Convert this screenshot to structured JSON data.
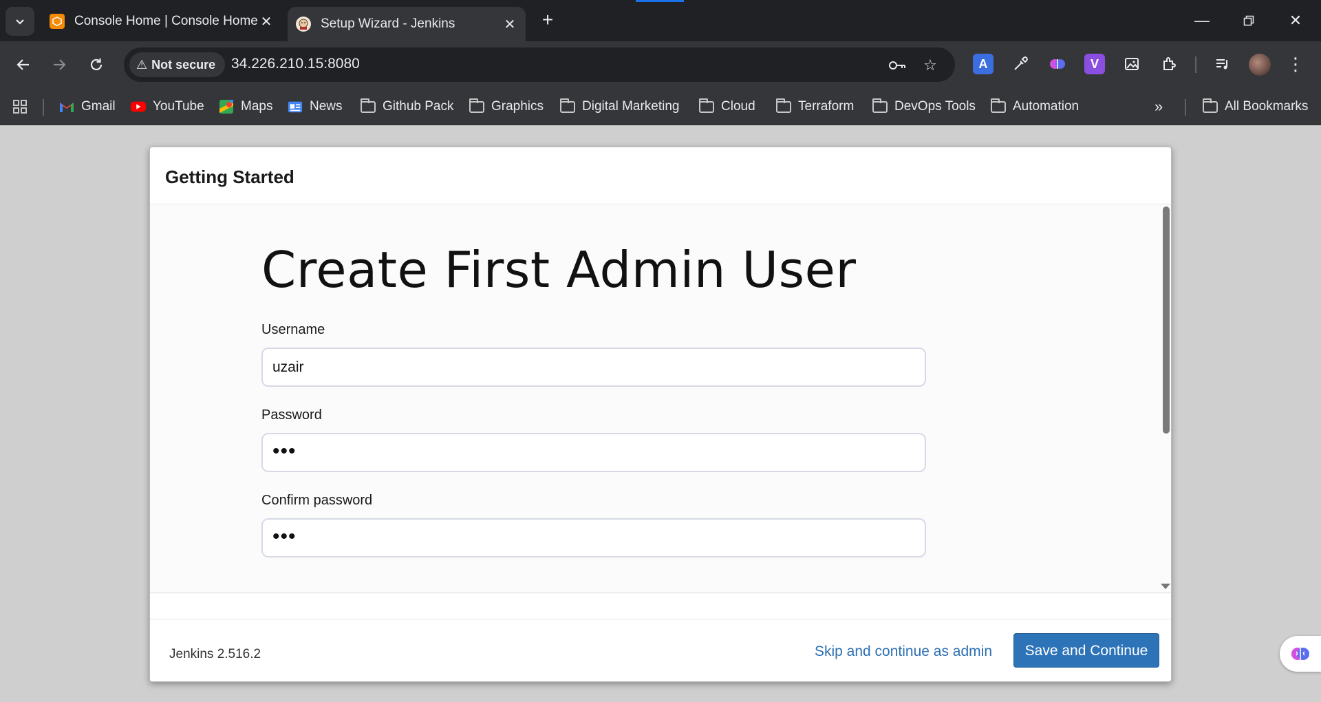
{
  "browser": {
    "tabs": [
      {
        "title": "Console Home | Console Home",
        "active": false
      },
      {
        "title": "Setup Wizard - Jenkins",
        "active": true
      }
    ],
    "security_label": "Not secure",
    "url": "34.226.210.15:8080",
    "bookmarks": [
      {
        "label": "Gmail",
        "icon": "gmail-icon"
      },
      {
        "label": "YouTube",
        "icon": "youtube-icon"
      },
      {
        "label": "Maps",
        "icon": "maps-icon"
      },
      {
        "label": "News",
        "icon": "news-icon"
      },
      {
        "label": "Github Pack",
        "icon": "folder-icon"
      },
      {
        "label": "Graphics",
        "icon": "folder-icon"
      },
      {
        "label": "Digital Marketing",
        "icon": "folder-icon"
      },
      {
        "label": "Cloud",
        "icon": "folder-icon"
      },
      {
        "label": "Terraform",
        "icon": "folder-icon"
      },
      {
        "label": "DevOps Tools",
        "icon": "folder-icon"
      },
      {
        "label": "Automation",
        "icon": "folder-icon"
      }
    ],
    "more_bookmarks": "»",
    "all_bookmarks": "All Bookmarks"
  },
  "dialog": {
    "header_title": "Getting Started",
    "heading": "Create First Admin User",
    "fields": {
      "username": {
        "label": "Username",
        "value": "uzair"
      },
      "password": {
        "label": "Password",
        "value": "•••"
      },
      "confirm_password": {
        "label": "Confirm password",
        "value": "•••"
      }
    },
    "version": "Jenkins 2.516.2",
    "skip_label": "Skip and continue as admin",
    "save_label": "Save and Continue"
  },
  "colors": {
    "accent": "#2d73b8",
    "link": "#2c6fb1",
    "chrome_dark": "#202124",
    "chrome_toolbar": "#35363a"
  }
}
